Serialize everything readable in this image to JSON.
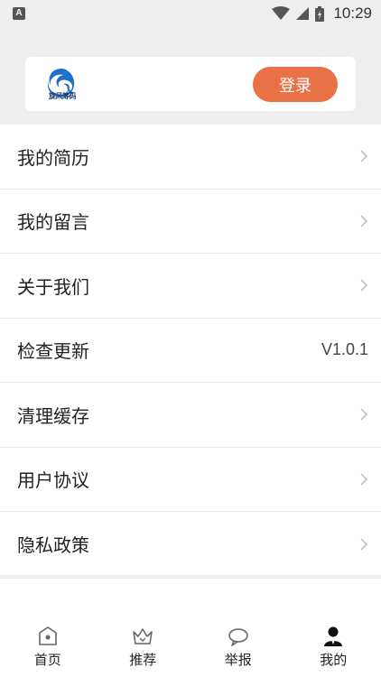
{
  "statusbar": {
    "time": "10:29",
    "notification_icon": "A"
  },
  "header": {
    "logo_text": "旋风筹码",
    "login_label": "登录"
  },
  "menu": {
    "items": [
      {
        "label": "我的简历",
        "value": ""
      },
      {
        "label": "我的留言",
        "value": ""
      },
      {
        "label": "关于我们",
        "value": ""
      },
      {
        "label": "检查更新",
        "value": "V1.0.1"
      },
      {
        "label": "清理缓存",
        "value": ""
      },
      {
        "label": "用户协议",
        "value": ""
      },
      {
        "label": "隐私政策",
        "value": ""
      }
    ]
  },
  "bottom_nav": {
    "items": [
      {
        "label": "首页",
        "icon": "home-icon"
      },
      {
        "label": "推荐",
        "icon": "crown-icon"
      },
      {
        "label": "举报",
        "icon": "chat-bubble-icon"
      },
      {
        "label": "我的",
        "icon": "user-icon"
      }
    ],
    "active_index": 3
  },
  "colors": {
    "accent": "#e87245",
    "background": "#eeeeee",
    "card": "#ffffff",
    "logo_blue": "#1e6fd0"
  }
}
